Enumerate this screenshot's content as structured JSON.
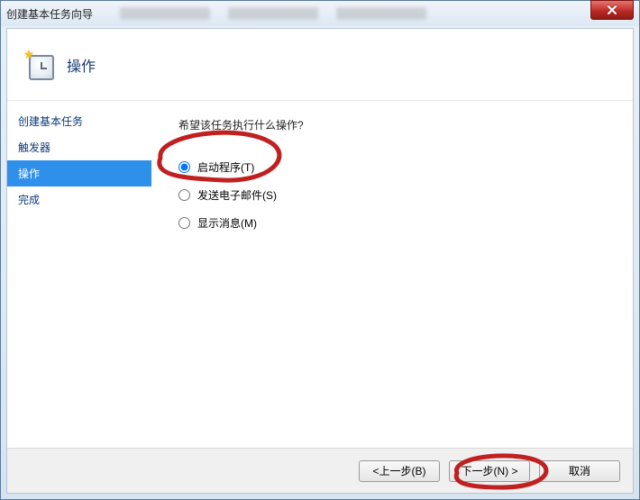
{
  "window": {
    "title": "创建基本任务向导"
  },
  "header": {
    "heading": "操作"
  },
  "sidebar": {
    "items": [
      {
        "label": "创建基本任务",
        "active": false
      },
      {
        "label": "触发器",
        "active": false
      },
      {
        "label": "操作",
        "active": true
      },
      {
        "label": "完成",
        "active": false
      }
    ]
  },
  "content": {
    "prompt": "希望该任务执行什么操作?",
    "options": [
      {
        "label": "启动程序(T)",
        "checked": true
      },
      {
        "label": "发送电子邮件(S)",
        "checked": false
      },
      {
        "label": "显示消息(M)",
        "checked": false
      }
    ]
  },
  "footer": {
    "back": "<上一步(B)",
    "next": "下一步(N) >",
    "cancel": "取消"
  },
  "annotation": {
    "color": "#c02020"
  }
}
